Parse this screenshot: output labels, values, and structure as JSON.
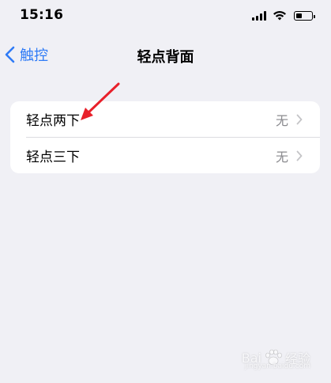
{
  "status_bar": {
    "time": "15:16"
  },
  "nav": {
    "back_label": "触控",
    "title": "轻点背面"
  },
  "settings": {
    "rows": [
      {
        "label": "轻点两下",
        "value": "无"
      },
      {
        "label": "轻点三下",
        "value": "无"
      }
    ]
  },
  "watermark": {
    "brand_left": "Bai",
    "brand_right": "经验",
    "sub": "jingyan.baidu.com"
  },
  "colors": {
    "accent": "#2f7bf6",
    "background": "#f0f0f5",
    "annotation": "#e8202a"
  }
}
